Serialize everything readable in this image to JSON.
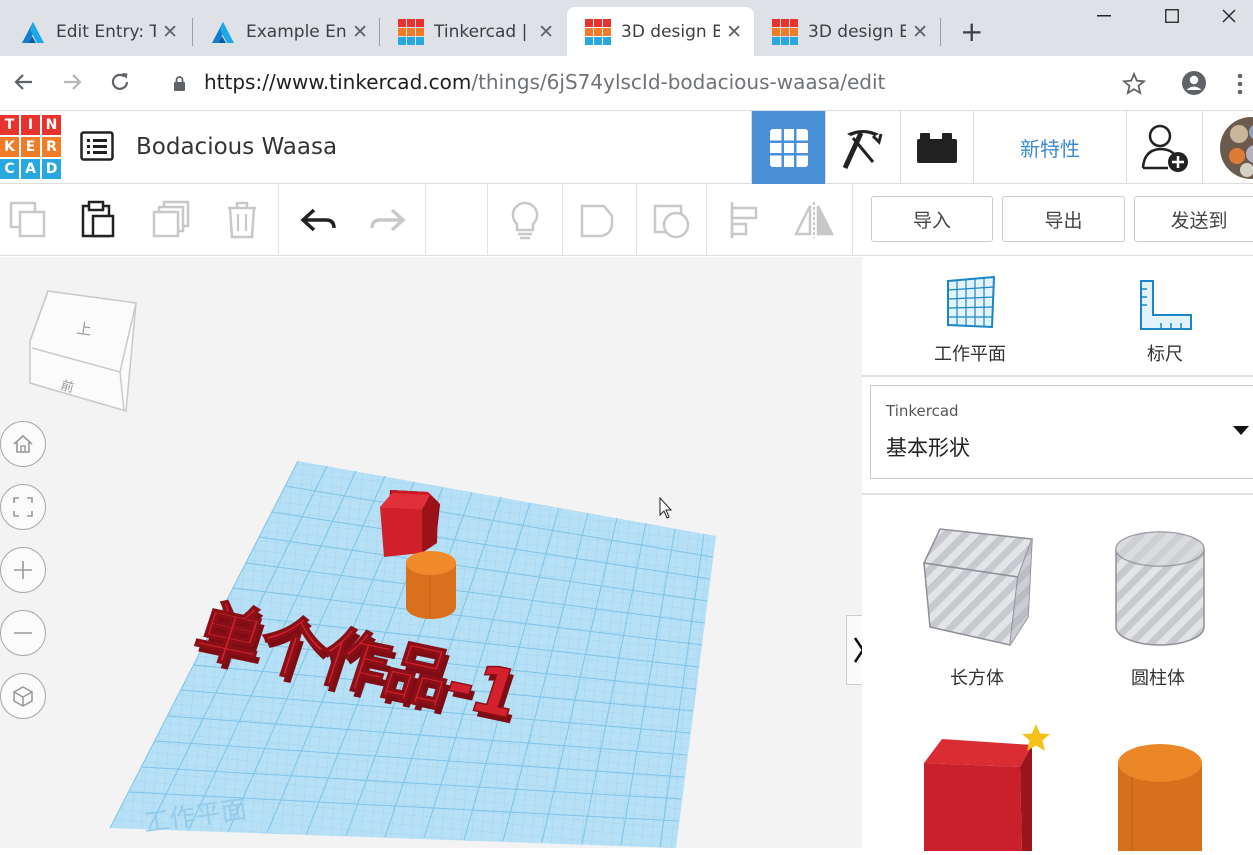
{
  "browser": {
    "tabs": [
      {
        "label": "Edit Entry: T",
        "icon": "autodesk-a-icon"
      },
      {
        "label": "Example En",
        "icon": "autodesk-a-icon"
      },
      {
        "label": "Tinkercad | (",
        "icon": "tinkercad-icon"
      },
      {
        "label": "3D design B",
        "icon": "tinkercad-icon",
        "active": true
      },
      {
        "label": "3D design B",
        "icon": "tinkercad-icon"
      }
    ],
    "url_host": "https://www.tinkercad.com",
    "url_path": "/things/6jS74ylscId-bodacious-waasa/edit"
  },
  "app": {
    "logo_letters": [
      "T",
      "I",
      "N",
      "K",
      "E",
      "R",
      "C",
      "A",
      "D"
    ],
    "logo_colors": [
      "#e8322e",
      "#e8322e",
      "#e8322e",
      "#f27b28",
      "#f27b28",
      "#f27b28",
      "#29a8e0",
      "#29a8e0",
      "#29a8e0"
    ],
    "design_title": "Bodacious Waasa",
    "new_features_label": "新特性",
    "accent_color": "#4a90d9"
  },
  "toolbar": {
    "import_label": "导入",
    "export_label": "导出",
    "send_to_label": "发送到"
  },
  "viewcube": {
    "top_label": "上",
    "front_label": "前"
  },
  "workspace": {
    "text_3d": "单个作品-1",
    "grid_watermark": "工作平面"
  },
  "panel": {
    "workplane_label": "工作平面",
    "ruler_label": "标尺",
    "library_caption": "Tinkercad",
    "library_value": "基本形状",
    "shapes": [
      {
        "label": "长方体"
      },
      {
        "label": "圆柱体"
      }
    ]
  }
}
